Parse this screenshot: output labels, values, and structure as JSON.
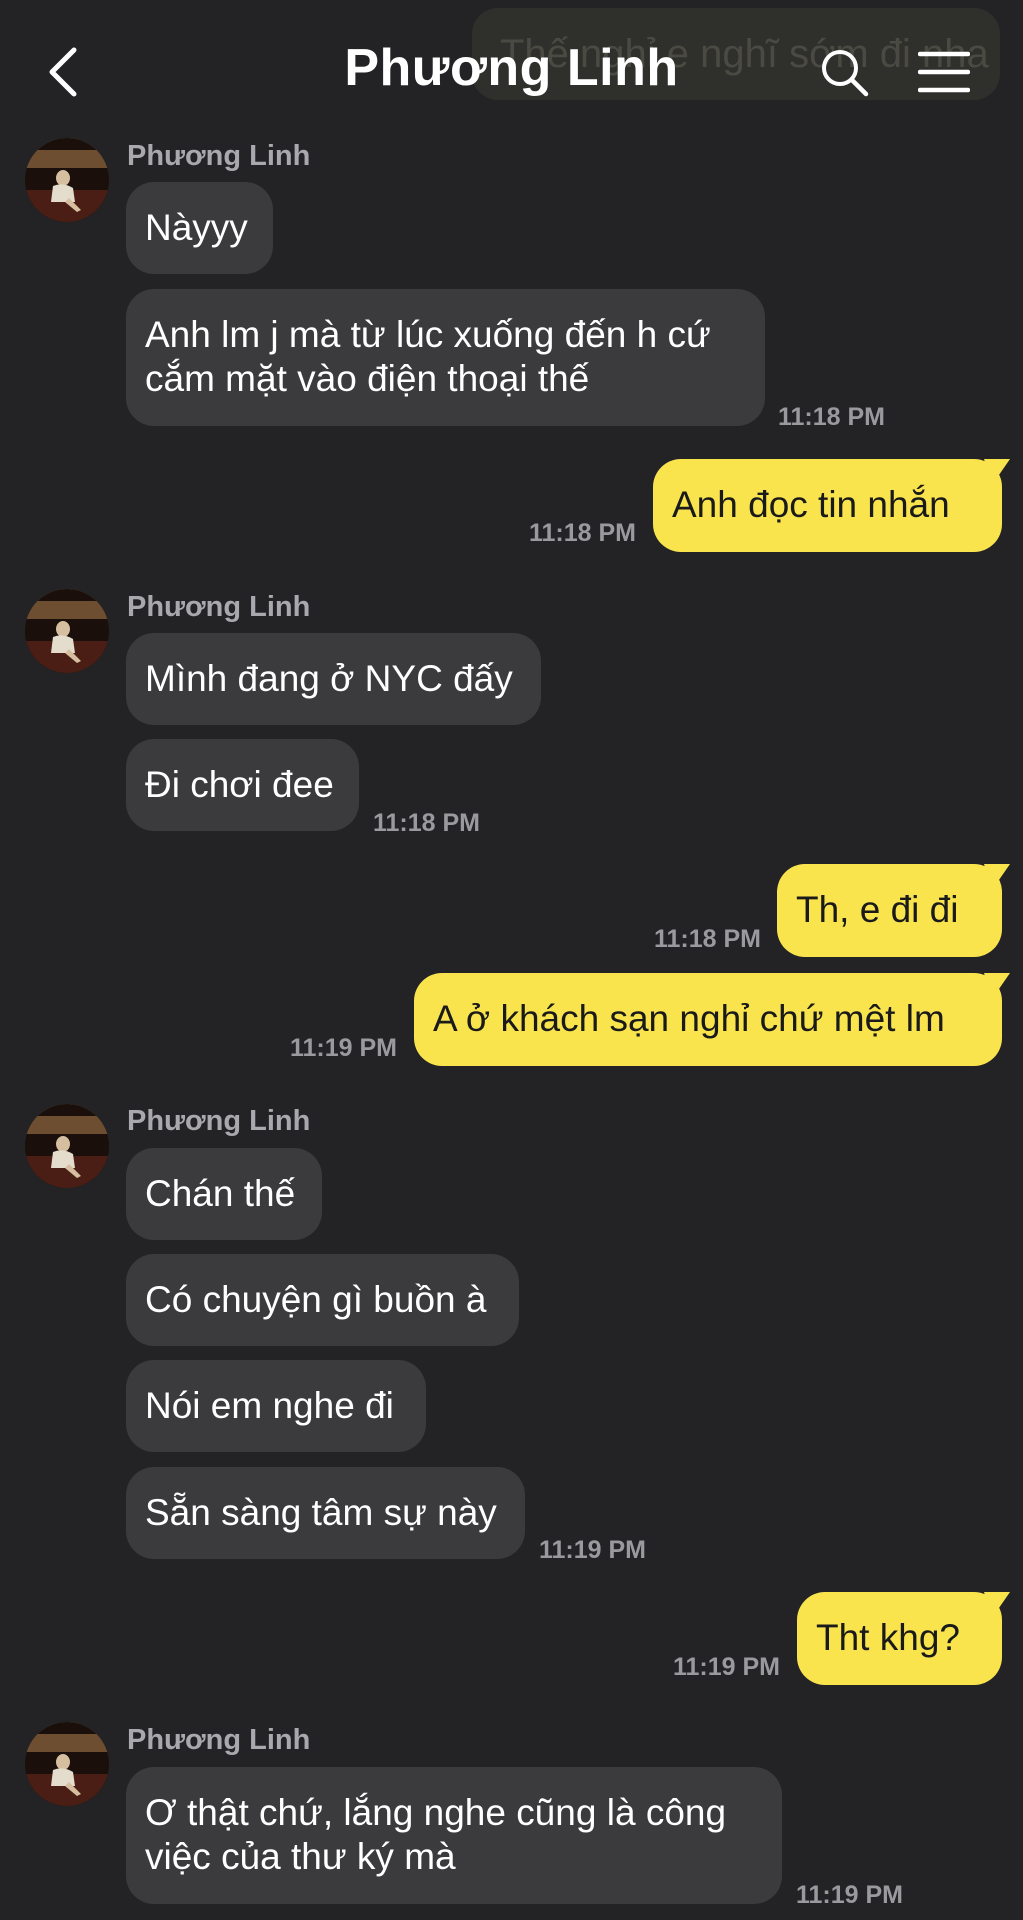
{
  "header": {
    "title": "Phương Linh",
    "background_bubble_text": "Thế nghỉ e nghĩ sớm đi nha"
  },
  "contact": {
    "name": "Phương Linh"
  },
  "messages": [
    {
      "text": "Nàyyy"
    },
    {
      "text": "Anh lm j mà từ lúc xuống đến h cứ cắm mặt vào điện thoại thế",
      "time": "11:18 PM"
    },
    {
      "text": "Anh đọc tin nhắn",
      "time": "11:18 PM"
    },
    {
      "text": "Mình đang ở NYC đấy"
    },
    {
      "text": "Đi chơi đee",
      "time": "11:18 PM"
    },
    {
      "text": "Th, e đi đi",
      "time": "11:18 PM"
    },
    {
      "text": "A ở khách sạn nghỉ chứ mệt lm",
      "time": "11:19 PM"
    },
    {
      "text": "Chán thế"
    },
    {
      "text": "Có chuyện gì buồn à"
    },
    {
      "text": "Nói em nghe đi"
    },
    {
      "text": "Sẵn sàng tâm sự này",
      "time": "11:19 PM"
    },
    {
      "text": "Tht khg?",
      "time": "11:19 PM"
    },
    {
      "text": "Ơ thật chứ, lắng nghe cũng là công việc của thư ký mà",
      "time": "11:19 PM"
    }
  ],
  "colors": {
    "background": "#232325",
    "incoming_bubble": "#3b3b3e",
    "outgoing_bubble": "#f9e44e"
  }
}
